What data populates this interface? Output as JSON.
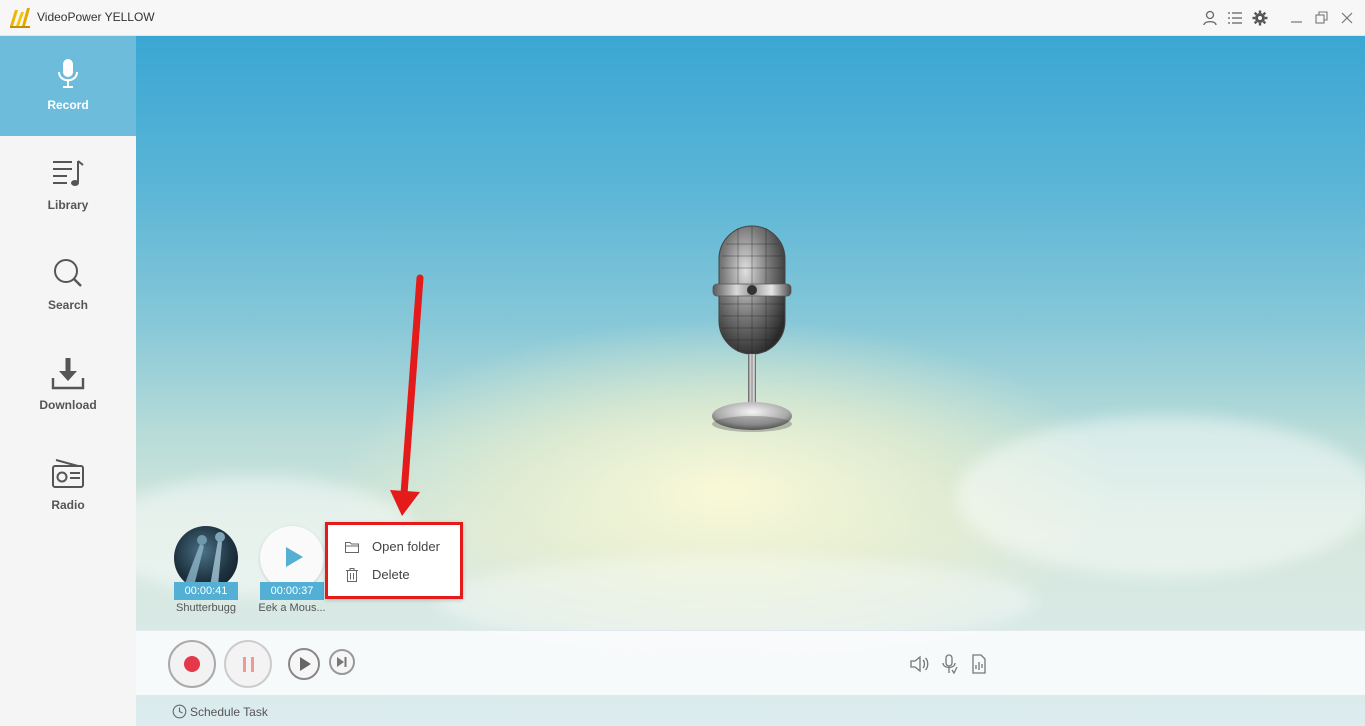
{
  "app": {
    "title": "VideoPower YELLOW"
  },
  "sidebar": {
    "items": [
      {
        "label": "Record",
        "icon": "microphone-icon",
        "active": true
      },
      {
        "label": "Library",
        "icon": "music-list-icon",
        "active": false
      },
      {
        "label": "Search",
        "icon": "search-icon",
        "active": false
      },
      {
        "label": "Download",
        "icon": "download-icon",
        "active": false
      },
      {
        "label": "Radio",
        "icon": "radio-icon",
        "active": false
      }
    ]
  },
  "recent_tracks": [
    {
      "name": "Shutterbugg",
      "duration": "00:00:41"
    },
    {
      "name": "Eek a Mous...",
      "duration": "00:00:37"
    }
  ],
  "context_menu": {
    "items": [
      {
        "label": "Open folder",
        "icon": "folder-icon"
      },
      {
        "label": "Delete",
        "icon": "trash-icon"
      }
    ]
  },
  "bottom": {
    "schedule_label": "Schedule Task"
  },
  "colors": {
    "accent": "#6dbcdc",
    "duration_badge": "#53afd4",
    "record": "#e5384a",
    "annotation": "#e41b1b"
  }
}
